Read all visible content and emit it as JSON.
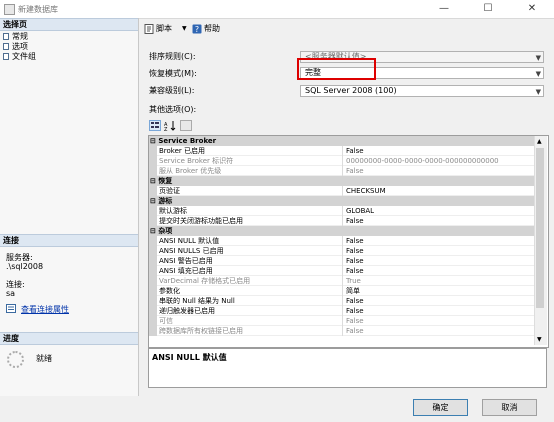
{
  "window": {
    "title": "新建数据库"
  },
  "left": {
    "select_page_header": "选择页",
    "pages": [
      "常规",
      "选项",
      "文件组"
    ],
    "connection_header": "连接",
    "server_label": "服务器:",
    "server_value": ".\\sql2008",
    "connection_label": "连接:",
    "connection_value": "sa",
    "view_properties_link": "查看连接属性",
    "progress_header": "进度",
    "progress_status": "就绪"
  },
  "toolbar": {
    "script_label": "脚本",
    "help_label": "帮助"
  },
  "form": {
    "collation_label": "排序规则(C):",
    "collation_value": "<服务器默认值>",
    "recovery_label": "恢复模式(M):",
    "recovery_value": "完整",
    "compat_label": "兼容级别(L):",
    "compat_value": "SQL Server 2008 (100)",
    "other_options_label": "其他选项(O):"
  },
  "grid": {
    "sections": [
      {
        "category": "Service Broker",
        "rows": [
          {
            "name": "Broker 已启用",
            "value": "False",
            "dim": false
          },
          {
            "name": "Service Broker 标识符",
            "value": "00000000-0000-0000-0000-000000000000",
            "dim": true
          },
          {
            "name": "服从 Broker 优先级",
            "value": "False",
            "dim": true
          }
        ]
      },
      {
        "category": "恢复",
        "rows": [
          {
            "name": "页验证",
            "value": "CHECKSUM",
            "dim": false
          }
        ]
      },
      {
        "category": "游标",
        "rows": [
          {
            "name": "默认游标",
            "value": "GLOBAL",
            "dim": false
          },
          {
            "name": "提交时关闭游标功能已启用",
            "value": "False",
            "dim": false
          }
        ]
      },
      {
        "category": "杂项",
        "rows": [
          {
            "name": "ANSI NULL 默认值",
            "value": "False",
            "dim": false
          },
          {
            "name": "ANSI NULLS 已启用",
            "value": "False",
            "dim": false
          },
          {
            "name": "ANSI 警告已启用",
            "value": "False",
            "dim": false
          },
          {
            "name": "ANSI 填充已启用",
            "value": "False",
            "dim": false
          },
          {
            "name": "VarDecimal 存储格式已启用",
            "value": "True",
            "dim": true
          },
          {
            "name": "参数化",
            "value": "简单",
            "dim": false
          },
          {
            "name": "串联的 Null 结果为 Null",
            "value": "False",
            "dim": false
          },
          {
            "name": "递归触发器已启用",
            "value": "False",
            "dim": false
          },
          {
            "name": "可信",
            "value": "False",
            "dim": true
          },
          {
            "name": "跨数据库所有权链接已启用",
            "value": "False",
            "dim": true
          }
        ]
      }
    ]
  },
  "description": "ANSI NULL 默认值",
  "buttons": {
    "ok": "确定",
    "cancel": "取消"
  }
}
